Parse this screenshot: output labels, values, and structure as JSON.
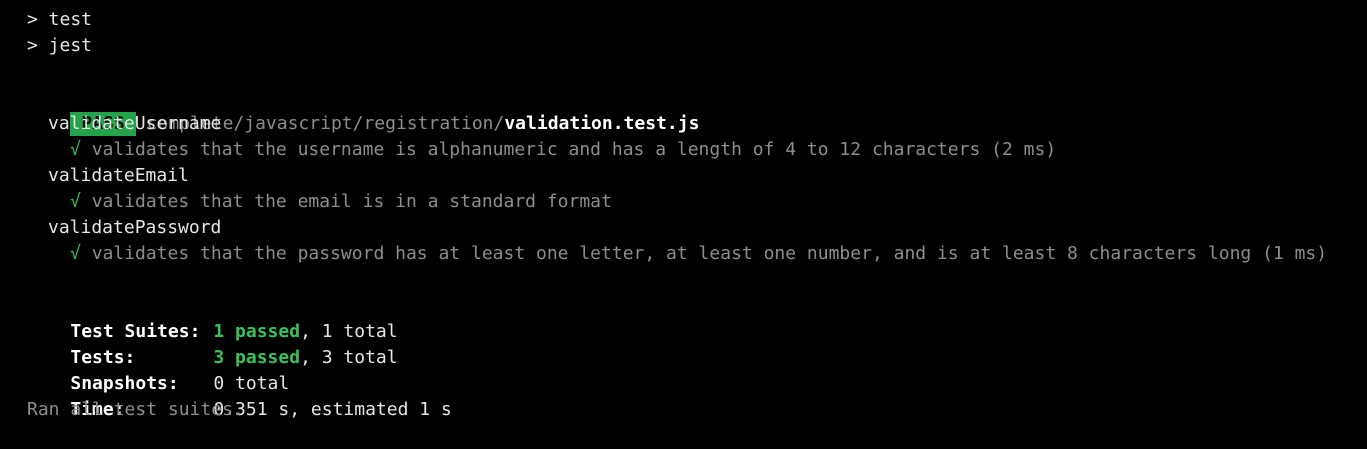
{
  "prompt_lines": [
    "> test",
    "> jest"
  ],
  "result": {
    "badge": "PASS",
    "path_dim": "complete/javascript/registration/",
    "file": "validation.test.js"
  },
  "suites": [
    {
      "name": "validateUsername",
      "tests": [
        {
          "check": "√",
          "text": "validates that the username is alphanumeric and has a length of 4 to 12 characters (2 ms)"
        }
      ]
    },
    {
      "name": "validateEmail",
      "tests": [
        {
          "check": "√",
          "text": "validates that the email is in a standard format"
        }
      ]
    },
    {
      "name": "validatePassword",
      "tests": [
        {
          "check": "√",
          "text": "validates that the password has at least one letter, at least one number, and is at least 8 characters long (1 ms)"
        }
      ]
    }
  ],
  "summary": {
    "suites_label": "Test Suites:",
    "suites_passed": "1 passed",
    "suites_total": ", 1 total",
    "tests_label": "Tests:",
    "tests_passed": "3 passed",
    "tests_total": ", 3 total",
    "snapshots_label": "Snapshots:",
    "snapshots_value": "0 total",
    "time_label": "Time:",
    "time_value": "0.351 s, estimated 1 s",
    "footer": "Ran all test suites."
  },
  "colors": {
    "background": "#000000",
    "pass_badge": "#23a34a",
    "pass_text": "#39c35a",
    "dim_text": "#8d8d8d"
  }
}
